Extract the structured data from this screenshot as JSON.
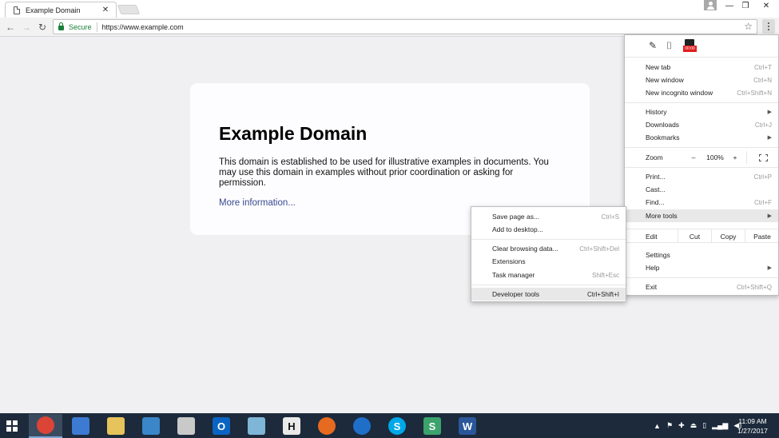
{
  "browser": {
    "tab_title": "Example Domain",
    "tab_close": "✕",
    "secure_label": "Secure",
    "url": "https://www.example.com"
  },
  "window_controls": {
    "minimize": "—",
    "restore": "❐",
    "close": "✕"
  },
  "page": {
    "heading": "Example Domain",
    "paragraph": "This domain is established to be used for illustrative examples in documents. You may use this domain in examples without prior coordination or asking for permission.",
    "link": "More information..."
  },
  "menu": {
    "recorder_label": "00:00",
    "new_tab": {
      "label": "New tab",
      "shortcut": "Ctrl+T"
    },
    "new_window": {
      "label": "New window",
      "shortcut": "Ctrl+N"
    },
    "new_incognito": {
      "label": "New incognito window",
      "shortcut": "Ctrl+Shift+N"
    },
    "history": {
      "label": "History"
    },
    "downloads": {
      "label": "Downloads",
      "shortcut": "Ctrl+J"
    },
    "bookmarks": {
      "label": "Bookmarks"
    },
    "zoom": {
      "label": "Zoom",
      "minus": "–",
      "level": "100%",
      "plus": "+"
    },
    "print": {
      "label": "Print...",
      "shortcut": "Ctrl+P"
    },
    "cast": {
      "label": "Cast..."
    },
    "find": {
      "label": "Find...",
      "shortcut": "Ctrl+F"
    },
    "more_tools": {
      "label": "More tools"
    },
    "edit": {
      "label": "Edit",
      "cut": "Cut",
      "copy": "Copy",
      "paste": "Paste"
    },
    "settings": {
      "label": "Settings"
    },
    "help": {
      "label": "Help"
    },
    "exit": {
      "label": "Exit",
      "shortcut": "Ctrl+Shift+Q"
    }
  },
  "submenu": {
    "save_page": {
      "label": "Save page as...",
      "shortcut": "Ctrl+S"
    },
    "add_desktop": {
      "label": "Add to desktop..."
    },
    "clear_data": {
      "label": "Clear browsing data...",
      "shortcut": "Ctrl+Shift+Del"
    },
    "extensions": {
      "label": "Extensions"
    },
    "task_manager": {
      "label": "Task manager",
      "shortcut": "Shift+Esc"
    },
    "dev_tools": {
      "label": "Developer tools",
      "shortcut": "Ctrl+Shift+I"
    }
  },
  "taskbar": {
    "apps": [
      {
        "name": "chrome",
        "color": "#db4437",
        "glyph": ""
      },
      {
        "name": "control-panel",
        "color": "#3c7bd1",
        "glyph": ""
      },
      {
        "name": "file-explorer",
        "color": "#e7c35b",
        "glyph": ""
      },
      {
        "name": "remote-desktop",
        "color": "#3a86c8",
        "glyph": ""
      },
      {
        "name": "snipping-tool",
        "color": "#c9c9c9",
        "glyph": ""
      },
      {
        "name": "outlook",
        "color": "#0a64c2",
        "glyph": "O"
      },
      {
        "name": "notepad",
        "color": "#7fb6d8",
        "glyph": ""
      },
      {
        "name": "h-app",
        "color": "#e9e9e9",
        "glyph": "H"
      },
      {
        "name": "firefox",
        "color": "#e66a1f",
        "glyph": ""
      },
      {
        "name": "edge",
        "color": "#1f6fc9",
        "glyph": ""
      },
      {
        "name": "skype",
        "color": "#00a8e8",
        "glyph": "S"
      },
      {
        "name": "slack",
        "color": "#3ba36b",
        "glyph": "S"
      },
      {
        "name": "word",
        "color": "#2b579a",
        "glyph": "W"
      }
    ],
    "tray_arrow": "▲",
    "time": "11:09 AM",
    "date": "1/27/2017"
  }
}
